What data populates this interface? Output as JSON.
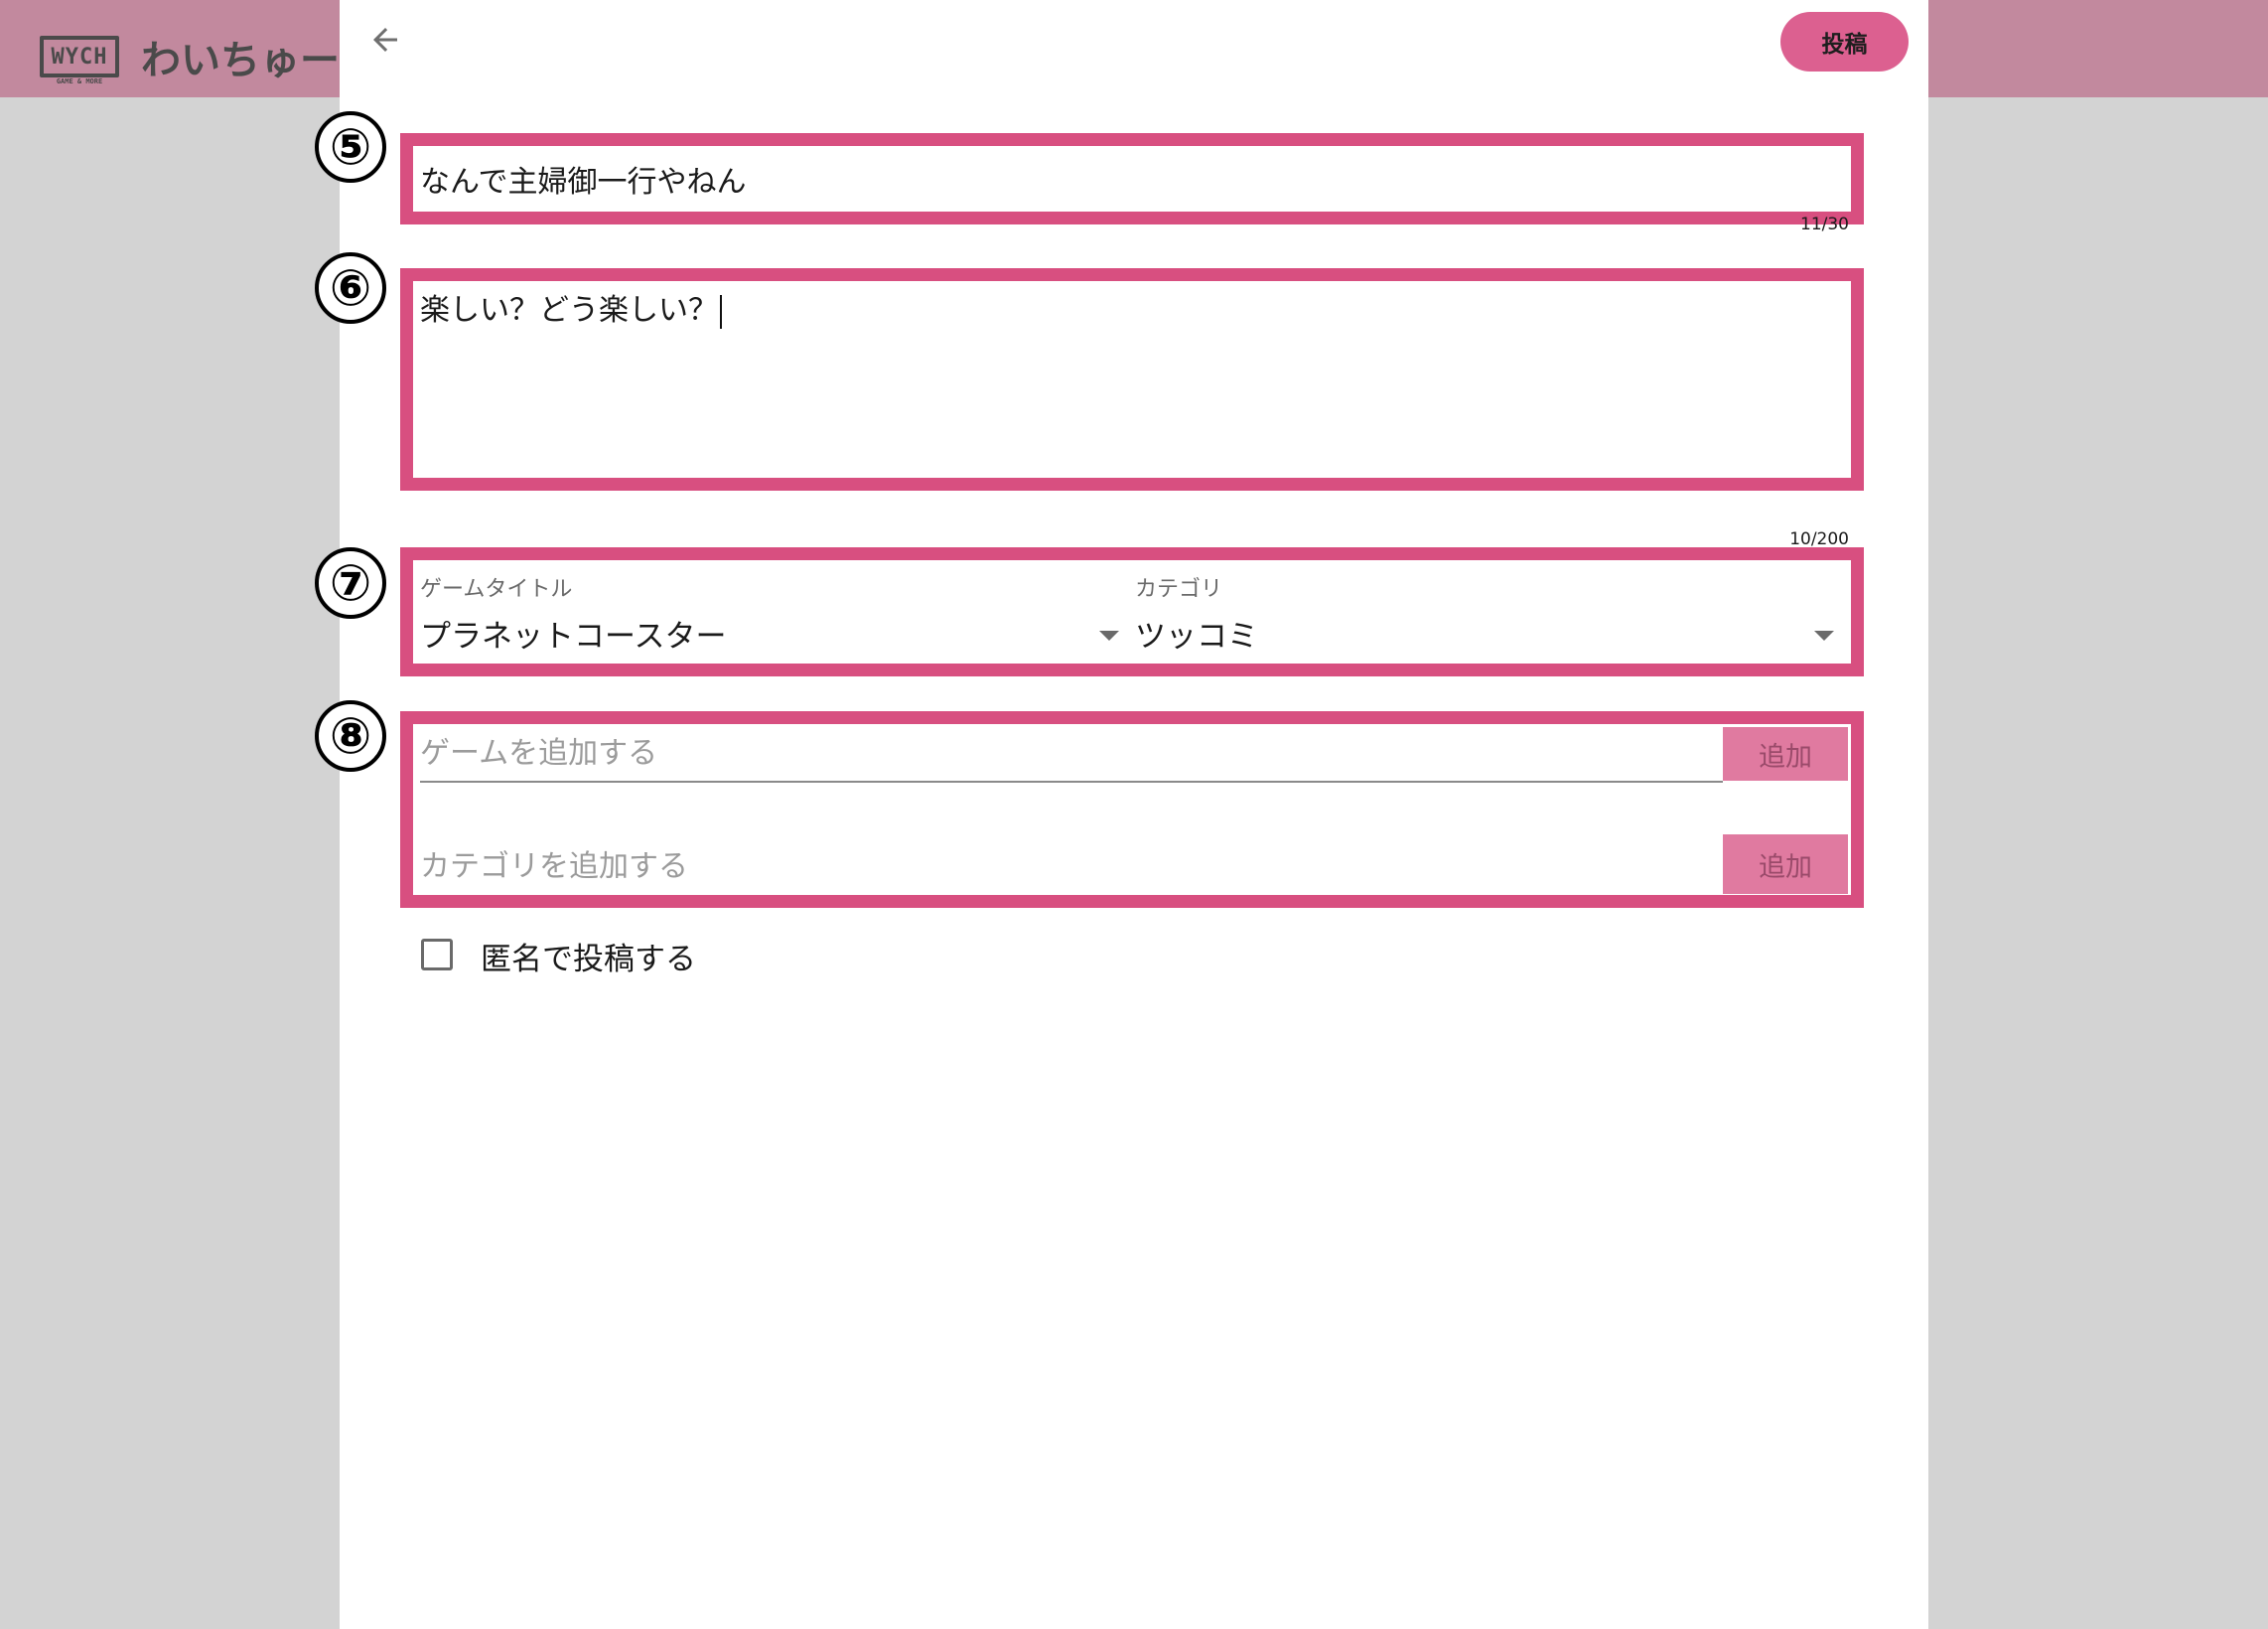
{
  "header": {
    "logo_mark": "WYCH",
    "logo_sub": "GAME & MORE",
    "app_name": "わいちゅー"
  },
  "toolbar": {
    "post_label": "投稿"
  },
  "annotations": {
    "step5": "⑤",
    "step6": "⑥",
    "step7": "⑦",
    "step8": "⑧"
  },
  "form": {
    "title_value": "なんで主婦御一行やねん",
    "title_counter": "11/30",
    "body_value": "楽しい？どう楽しい？",
    "body_counter": "10/200",
    "game_title_label": "ゲームタイトル",
    "game_title_value": "プラネットコースター",
    "category_label": "カテゴリ",
    "category_value": "ツッコミ",
    "add_game_placeholder": "ゲームを追加する",
    "add_game_button": "追加",
    "add_category_placeholder": "カテゴリを追加する",
    "add_category_button": "追加",
    "anonymous_label": "匿名で投稿する",
    "anonymous_checked": false
  },
  "colors": {
    "accent": "#dc6090",
    "highlight": "#d84f80",
    "header_bg": "#c2899e"
  },
  "icons": {
    "back": "arrow-left-icon",
    "dropdown": "chevron-down-icon"
  }
}
